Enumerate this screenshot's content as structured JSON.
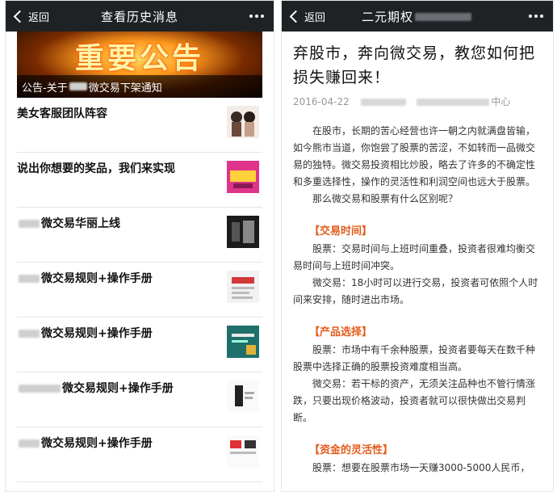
{
  "left": {
    "nav": {
      "back": "返回",
      "title": "查看历史消息"
    },
    "banner": {
      "art_text": "重要公告",
      "caption_prefix": "公告-关于",
      "caption_suffix": "微交易下架通知"
    },
    "items": [
      {
        "prefix": "",
        "title": "美女客服团队阵容"
      },
      {
        "prefix": "",
        "title": "说出你想要的奖品，我们来实现"
      },
      {
        "prefix": "blur",
        "title": "微交易华丽上线"
      },
      {
        "prefix": "blur",
        "title": "微交易规则+操作手册"
      },
      {
        "prefix": "blur",
        "title": "微交易规则+操作手册"
      },
      {
        "prefix": "blur",
        "title": "微交易规则+操作手册"
      },
      {
        "prefix": "blur",
        "title": "微交易规则+操作手册"
      }
    ]
  },
  "right": {
    "nav": {
      "back": "返回",
      "title_prefix": "二元期权"
    },
    "article": {
      "title": "弃股市，奔向微交易，教您如何把损失赚回来！",
      "date": "2016-04-22",
      "author_suffix": "中心",
      "intro": "在股市，长期的苦心经营也许一朝之内就满盘皆输，如今熊市当道，你饱尝了股票的苦涩，不如转而一品微交易的独特。微交易投资相比炒股，略去了许多的不确定性和多重选择性，操作的灵活性和利润空间也远大于股票。",
      "question": "那么微交易和股票有什么区别呢？",
      "s1": "【交易时间】",
      "s1_p1": "股票：交易时间与上班时间重叠，投资者很难均衡交易时间与上班时间冲突。",
      "s1_p2": "微交易：18小时可以进行交易，投资者可依照个人时间来安排，随时进出市场。",
      "s2": "【产品选择】",
      "s2_p1": "股票：市场中有千余种股票，投资者要每天在数千种股票中选择正确的股票投资难度相当高。",
      "s2_p2": "微交易：若干标的资产，无须关注品种也不管行情涨跌，只要出现价格波动，投资者就可以很快做出交易判断。",
      "s3": "【资金的灵活性】",
      "s3_p1": "股票：想要在股票市场一天赚3000-5000人民币，"
    }
  }
}
